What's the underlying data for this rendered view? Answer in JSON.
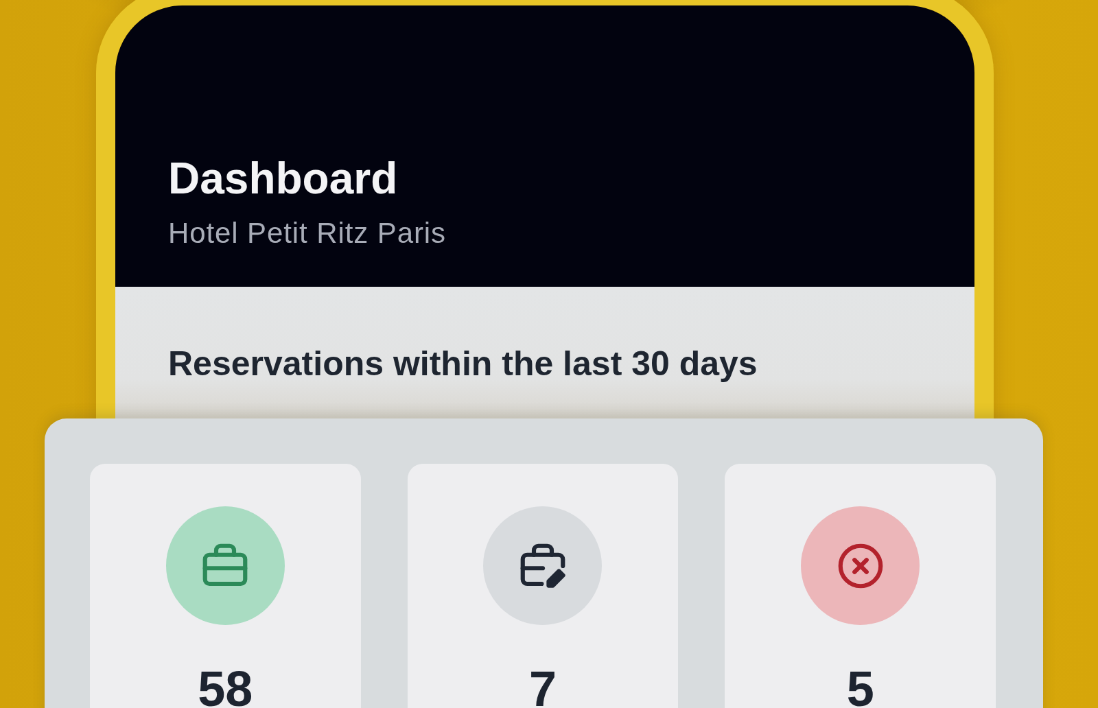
{
  "header": {
    "title": "Dashboard",
    "subtitle": "Hotel Petit Ritz Paris"
  },
  "summary": {
    "heading": "Reservations within the last 30 days",
    "stats": [
      {
        "kind": "briefcase",
        "color": "#a9dcc2",
        "value": "58"
      },
      {
        "kind": "edit",
        "color": "#d8dbde",
        "value": "7"
      },
      {
        "kind": "cancel",
        "color": "#ecb6b9",
        "value": "5"
      }
    ]
  }
}
